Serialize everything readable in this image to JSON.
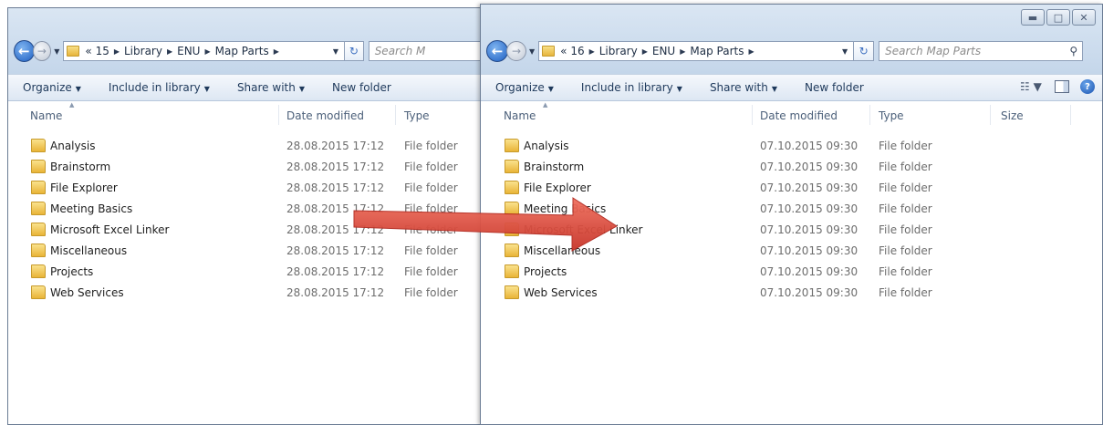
{
  "left_window": {
    "back_icon": "back-arrow-icon",
    "forward_icon": "forward-arrow-icon",
    "address": {
      "crumbs": [
        "« 15",
        "Library",
        "ENU",
        "Map Parts"
      ]
    },
    "search_placeholder": "Search M",
    "toolbar": {
      "organize": "Organize",
      "include": "Include in library",
      "share": "Share with",
      "new_folder": "New folder"
    },
    "columns": {
      "name": "Name",
      "date": "Date modified",
      "type": "Type"
    },
    "rows": [
      {
        "name": "Analysis",
        "date": "28.08.2015 17:12",
        "type": "File folder"
      },
      {
        "name": "Brainstorm",
        "date": "28.08.2015 17:12",
        "type": "File folder"
      },
      {
        "name": "File Explorer",
        "date": "28.08.2015 17:12",
        "type": "File folder"
      },
      {
        "name": "Meeting Basics",
        "date": "28.08.2015 17:12",
        "type": "File folder"
      },
      {
        "name": "Microsoft Excel Linker",
        "date": "28.08.2015 17:12",
        "type": "File folder"
      },
      {
        "name": "Miscellaneous",
        "date": "28.08.2015 17:12",
        "type": "File folder"
      },
      {
        "name": "Projects",
        "date": "28.08.2015 17:12",
        "type": "File folder"
      },
      {
        "name": "Web Services",
        "date": "28.08.2015 17:12",
        "type": "File folder"
      }
    ]
  },
  "right_window": {
    "address": {
      "crumbs": [
        "« 16",
        "Library",
        "ENU",
        "Map Parts"
      ]
    },
    "search_placeholder": "Search Map Parts",
    "toolbar": {
      "organize": "Organize",
      "include": "Include in library",
      "share": "Share with",
      "new_folder": "New folder"
    },
    "columns": {
      "name": "Name",
      "date": "Date modified",
      "type": "Type",
      "size": "Size"
    },
    "rows": [
      {
        "name": "Analysis",
        "date": "07.10.2015 09:30",
        "type": "File folder"
      },
      {
        "name": "Brainstorm",
        "date": "07.10.2015 09:30",
        "type": "File folder"
      },
      {
        "name": "File Explorer",
        "date": "07.10.2015 09:30",
        "type": "File folder"
      },
      {
        "name": "Meeting Basics",
        "date": "07.10.2015 09:30",
        "type": "File folder"
      },
      {
        "name": "Microsoft Excel Linker",
        "date": "07.10.2015 09:30",
        "type": "File folder"
      },
      {
        "name": "Miscellaneous",
        "date": "07.10.2015 09:30",
        "type": "File folder"
      },
      {
        "name": "Projects",
        "date": "07.10.2015 09:30",
        "type": "File folder"
      },
      {
        "name": "Web Services",
        "date": "07.10.2015 09:30",
        "type": "File folder"
      }
    ]
  },
  "annotation": {
    "arrow_color": "#e0463a"
  }
}
